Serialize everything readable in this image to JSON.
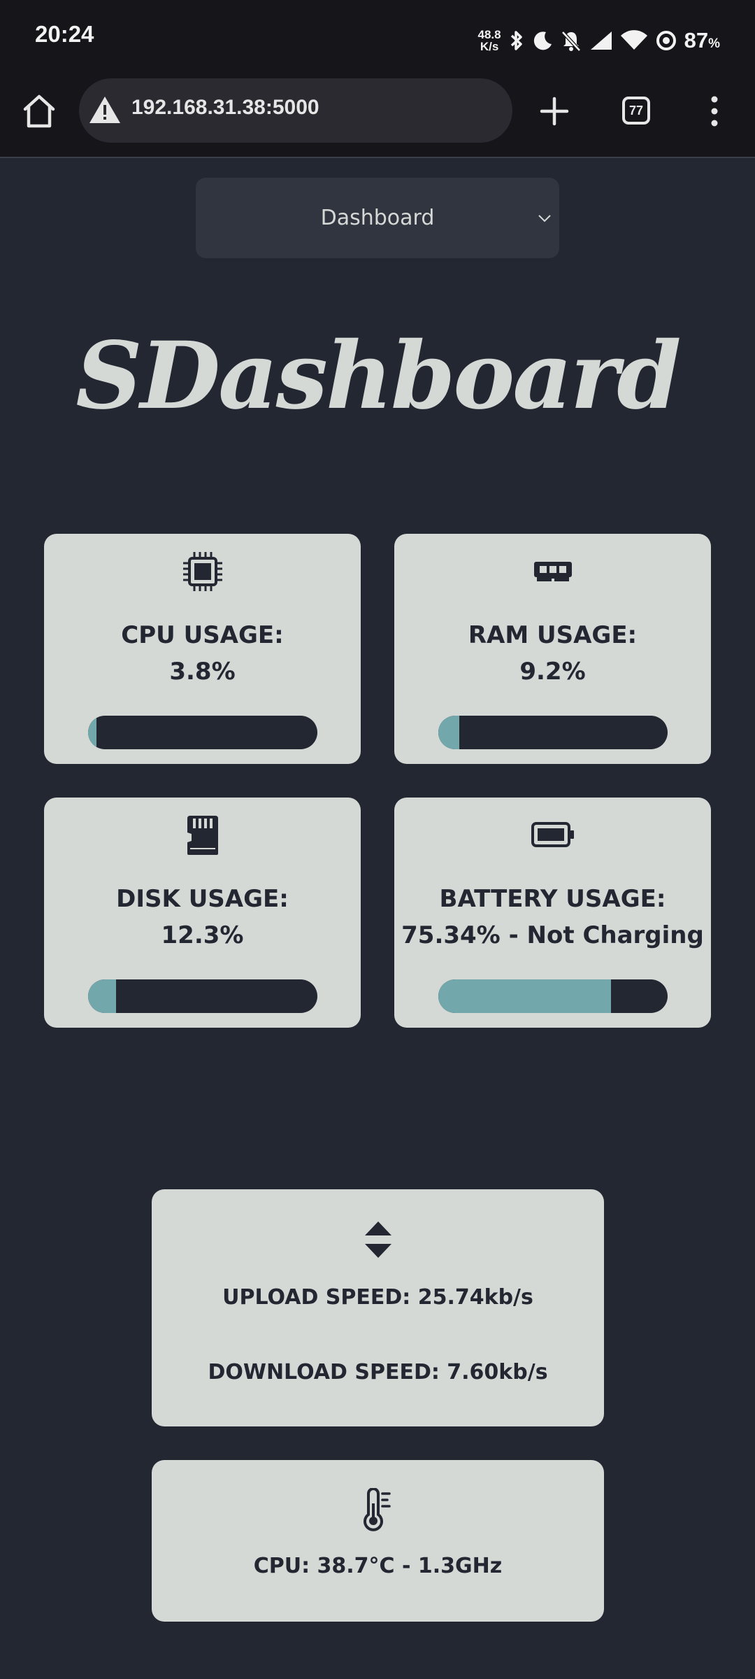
{
  "status_bar": {
    "time": "20:24",
    "net_speed_value": "48.8",
    "net_speed_unit": "K/s",
    "battery_percent": "87",
    "battery_suffix": "%"
  },
  "browser": {
    "url": "192.168.31.38:5000",
    "tab_count": "77"
  },
  "page_select": {
    "selected": "Dashboard"
  },
  "logo": "SDashboard",
  "cards": {
    "cpu": {
      "label": "CPU USAGE:",
      "value": "3.8%",
      "percent": 3.8
    },
    "ram": {
      "label": "RAM USAGE:",
      "value": "9.2%",
      "percent": 9.2
    },
    "disk": {
      "label": "DISK USAGE:",
      "value": "12.3%",
      "percent": 12.3
    },
    "battery": {
      "label": "BATTERY USAGE:",
      "value": "75.34% - Not Charging",
      "percent": 75.34
    }
  },
  "network": {
    "upload": "UPLOAD SPEED: 25.74kb/s",
    "download": "DOWNLOAD SPEED: 7.60kb/s"
  },
  "temperature": {
    "text": "CPU: 38.7°C - 1.3GHz"
  },
  "colors": {
    "background": "#222731",
    "card": "#d5d9d6",
    "progress_fill": "#72a8ab",
    "progress_track": "#222731"
  }
}
